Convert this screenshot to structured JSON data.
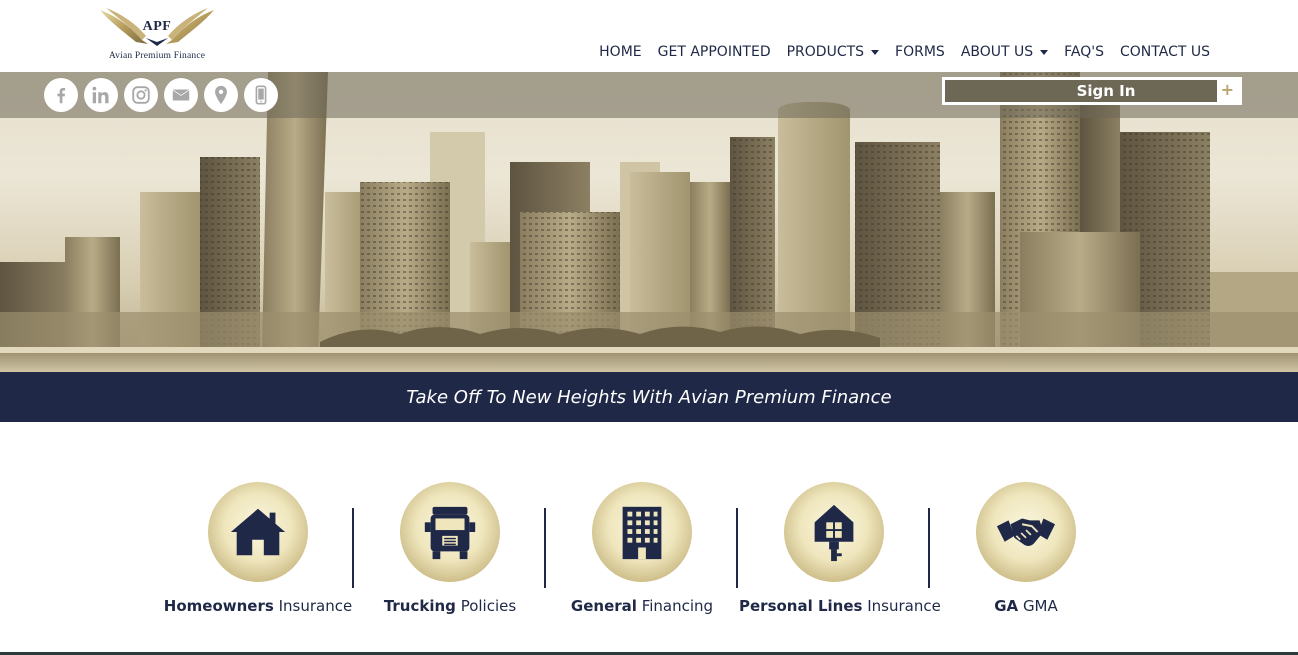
{
  "logo": {
    "abbr": "APF",
    "name": "Avian Premium Finance"
  },
  "nav": {
    "home": "HOME",
    "get_appointed": "GET APPOINTED",
    "products": "PRODUCTS",
    "forms": "FORMS",
    "about_us": "ABOUT US",
    "faqs": "FAQ'S",
    "contact_us": "CONTACT US"
  },
  "social": [
    "facebook-icon",
    "linkedin-icon",
    "instagram-icon",
    "mail-icon",
    "location-pin-icon",
    "mobile-phone-icon"
  ],
  "signin": {
    "label": "Sign In",
    "plus": "+"
  },
  "tagline": "Take Off To New Heights With Avian Premium Finance",
  "categories": [
    {
      "bold": "Homeowners",
      "rest": "Insurance",
      "icon": "house-icon"
    },
    {
      "bold": "Trucking",
      "rest": "Policies",
      "icon": "truck-icon"
    },
    {
      "bold": "General",
      "rest": "Financing",
      "icon": "office-building-icon"
    },
    {
      "bold": "Personal Lines",
      "rest": "Insurance",
      "icon": "house-key-icon"
    },
    {
      "bold": "GA",
      "rest": "GMA",
      "icon": "handshake-icon"
    }
  ],
  "colors": {
    "navy": "#1f2947",
    "gold": "#b9a56a",
    "sepia": "#d8ceb2"
  }
}
